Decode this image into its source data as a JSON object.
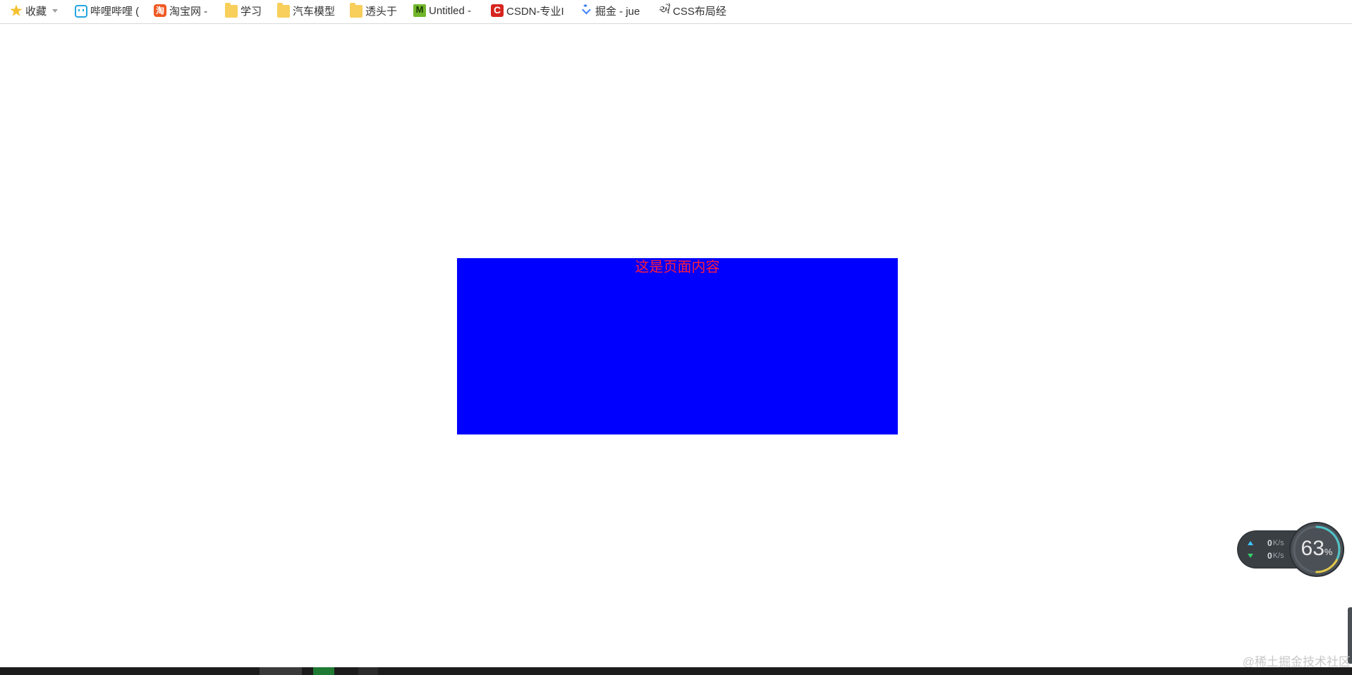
{
  "bookmarks_bar": {
    "items": [
      {
        "label": "收藏",
        "icon": "star-icon"
      },
      {
        "label": "哔哩哔哩 (",
        "icon": "bilibili-tv-icon"
      },
      {
        "label": "淘宝网 -",
        "icon": "taobao-icon",
        "icon_glyph": "淘"
      },
      {
        "label": "学习",
        "icon": "folder-icon"
      },
      {
        "label": "汽车模型",
        "icon": "folder-icon"
      },
      {
        "label": "透头于",
        "icon": "folder-icon"
      },
      {
        "label": "Untitled -",
        "icon": "m-icon",
        "icon_glyph": "M"
      },
      {
        "label": "CSDN-专业I",
        "icon": "csdn-icon",
        "icon_glyph": "C"
      },
      {
        "label": "掘金 - jue",
        "icon": "juejin-icon"
      },
      {
        "label": "CSS布局经",
        "icon": "css-icon",
        "icon_glyph": "ઐ"
      }
    ]
  },
  "main": {
    "content_text": "这是页面内容",
    "box_color": "#0000ff",
    "text_color": "#ff1c3c"
  },
  "net_widget": {
    "upload_value": "0",
    "upload_unit": "K/s",
    "download_value": "0",
    "download_unit": "K/s",
    "usage_percent": "63",
    "percent_sign": "%"
  },
  "watermark": "@稀土掘金技术社区"
}
